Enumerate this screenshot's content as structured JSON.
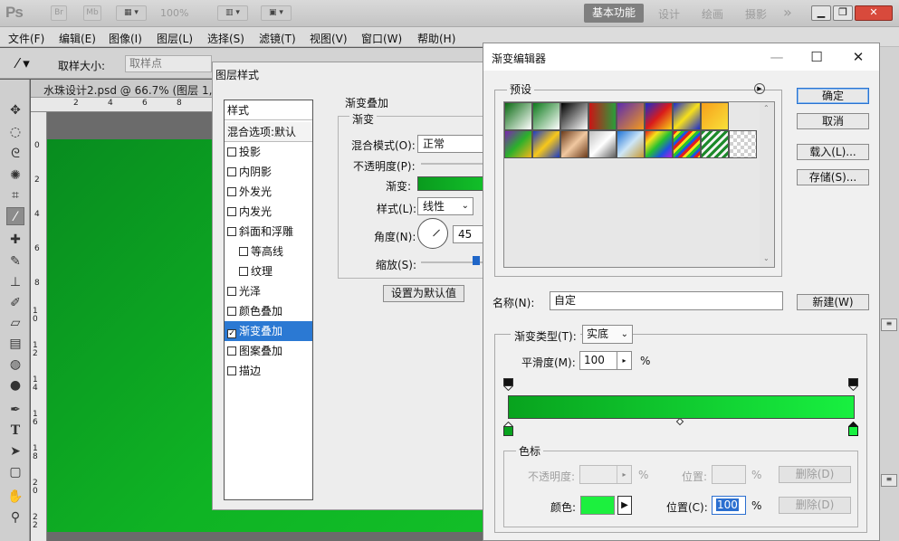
{
  "appbar": {
    "logo": "Ps",
    "br": "Br",
    "mb": "Mb",
    "zoom": "100%",
    "workspace_active": "基本功能",
    "workspaces": [
      "设计",
      "绘画",
      "摄影"
    ],
    "more": "»"
  },
  "menu": [
    "文件(F)",
    "编辑(E)",
    "图像(I)",
    "图层(L)",
    "选择(S)",
    "滤镜(T)",
    "视图(V)",
    "窗口(W)",
    "帮助(H)"
  ],
  "options": {
    "sample_size_label": "取样大小:",
    "sample_size_value": "取样点"
  },
  "document": {
    "tab": "水珠设计2.psd @ 66.7% (图层 1, R",
    "ruler_top": [
      "2",
      "4",
      "6",
      "8"
    ],
    "ruler_left": [
      "0",
      "2",
      "4",
      "6",
      "8",
      "1 0",
      "1 2",
      "1 4",
      "1 6",
      "1 8",
      "2 0",
      "2 2"
    ]
  },
  "layer_style": {
    "title": "图层样式",
    "list_header": "样式",
    "blend_default": "混合选项:默认",
    "items": [
      {
        "label": "投影",
        "checked": false,
        "indent": false
      },
      {
        "label": "内阴影",
        "checked": false,
        "indent": false
      },
      {
        "label": "外发光",
        "checked": false,
        "indent": false
      },
      {
        "label": "内发光",
        "checked": false,
        "indent": false
      },
      {
        "label": "斜面和浮雕",
        "checked": false,
        "indent": false
      },
      {
        "label": "等高线",
        "checked": false,
        "indent": true
      },
      {
        "label": "纹理",
        "checked": false,
        "indent": true
      },
      {
        "label": "光泽",
        "checked": false,
        "indent": false
      },
      {
        "label": "颜色叠加",
        "checked": false,
        "indent": false
      },
      {
        "label": "渐变叠加",
        "checked": true,
        "indent": false
      },
      {
        "label": "图案叠加",
        "checked": false,
        "indent": false
      },
      {
        "label": "描边",
        "checked": false,
        "indent": false
      }
    ],
    "section_title": "渐变叠加",
    "group_title": "渐变",
    "blend_mode_label": "混合模式(O):",
    "blend_mode_value": "正常",
    "opacity_label": "不透明度(P):",
    "gradient_label": "渐变:",
    "style_label": "样式(L):",
    "style_value": "线性",
    "angle_label": "角度(N):",
    "angle_value": "45",
    "scale_label": "缩放(S):",
    "set_default_button": "设置为默认值"
  },
  "gradient_editor": {
    "title": "渐变编辑器",
    "presets_label": "预设",
    "ok": "确定",
    "cancel": "取消",
    "load": "载入(L)...",
    "save": "存储(S)...",
    "name_label": "名称(N):",
    "name_value": "自定",
    "new_button": "新建(W)",
    "type_label": "渐变类型(T):",
    "type_value": "实底",
    "smoothness_label": "平滑度(M):",
    "smoothness_value": "100",
    "percent": "%",
    "stops_label": "色标",
    "stop_opacity_label": "不透明度:",
    "stop_location_label": "位置:",
    "delete_button": "删除(D)",
    "color_label": "颜色:",
    "color_location_label": "位置(C):",
    "color_location_value": "100",
    "gradient_start_color": "#08a31e",
    "gradient_end_color": "#18f040"
  }
}
